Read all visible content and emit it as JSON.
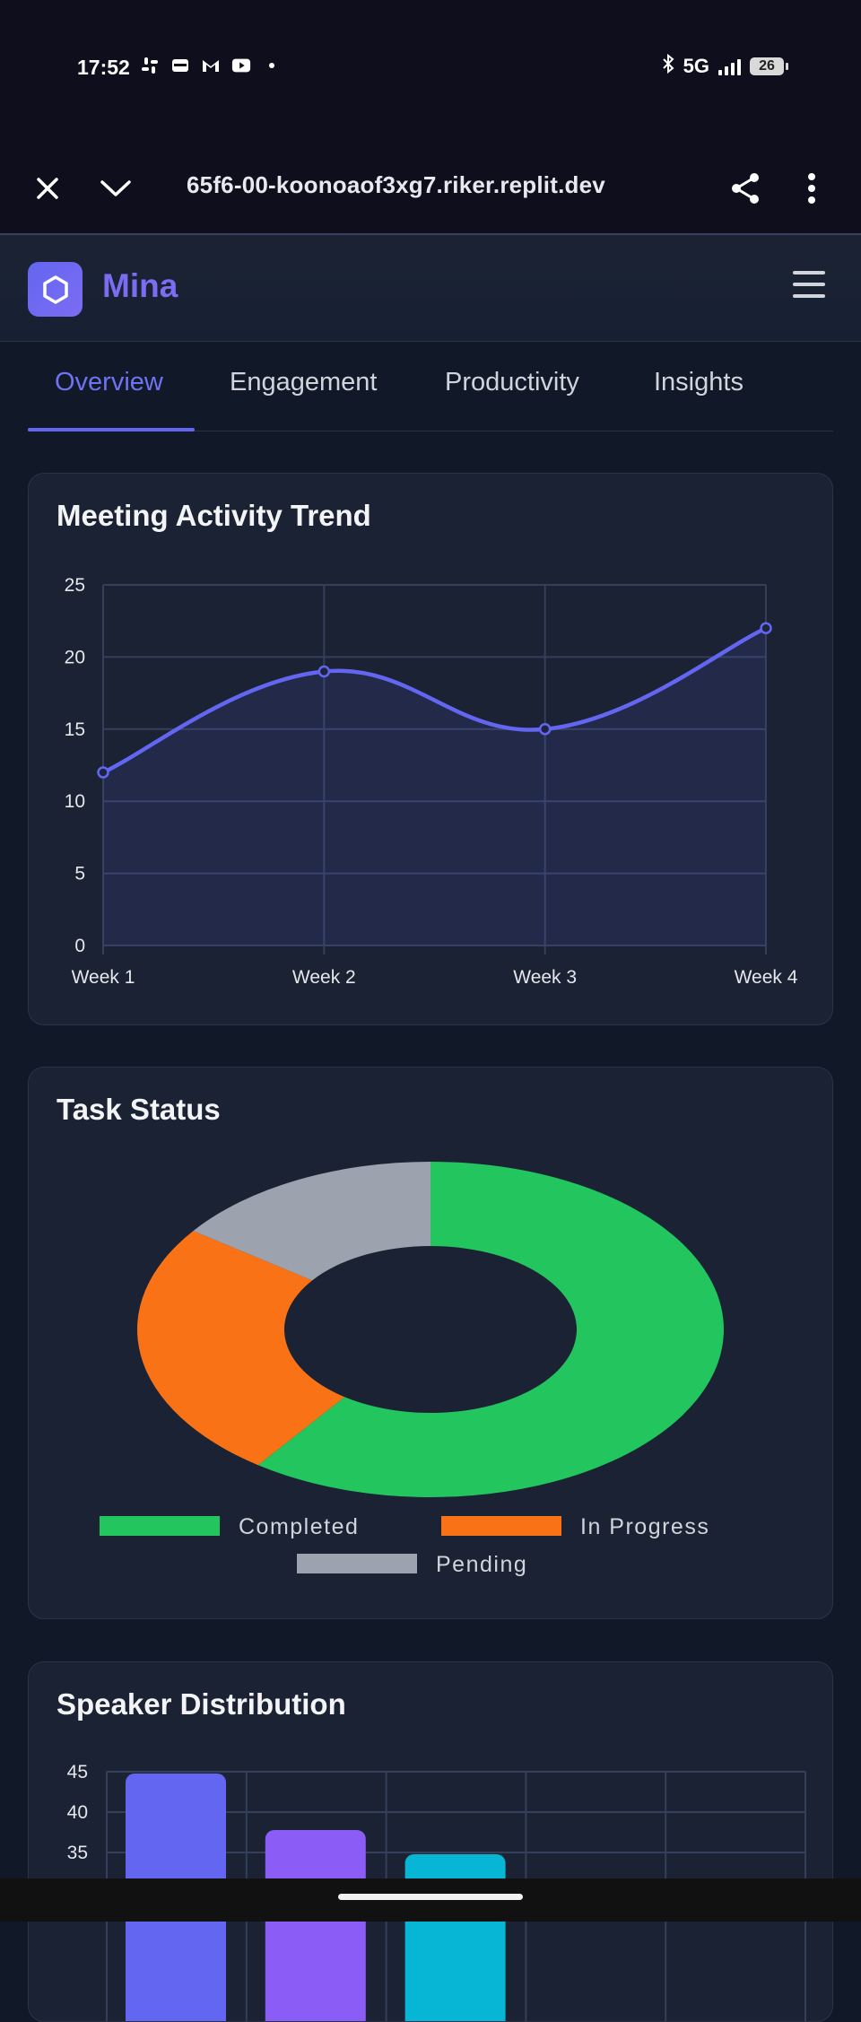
{
  "status_bar": {
    "time": "17:52",
    "network": "5G",
    "battery": "26",
    "left_icons": [
      "slack-icon",
      "wallet-icon",
      "gmail-icon",
      "youtube-icon",
      "dot-icon"
    ]
  },
  "browser": {
    "url": "65f6-00-koonoaof3xg7.riker.replit.dev"
  },
  "app": {
    "name": "Mina"
  },
  "tabs": [
    {
      "label": "Overview",
      "active": true
    },
    {
      "label": "Engagement",
      "active": false
    },
    {
      "label": "Productivity",
      "active": false
    },
    {
      "label": "Insights",
      "active": false
    }
  ],
  "cards": {
    "meeting": {
      "title": "Meeting Activity Trend"
    },
    "tasks": {
      "title": "Task Status"
    },
    "speakers": {
      "title": "Speaker Distribution"
    }
  },
  "chart_data": [
    {
      "type": "line",
      "title": "Meeting Activity Trend",
      "x": [
        "Week 1",
        "Week 2",
        "Week 3",
        "Week 4"
      ],
      "series": [
        {
          "values": [
            12,
            19,
            15,
            22
          ],
          "color": "#6366f1"
        }
      ],
      "ylim": [
        0,
        25
      ],
      "yticks": [
        0,
        5,
        10,
        15,
        20,
        25
      ],
      "grid": true,
      "fill": true
    },
    {
      "type": "pie",
      "title": "Task Status",
      "donut": true,
      "categories": [
        "Completed",
        "In Progress",
        "Pending"
      ],
      "values": [
        60,
        25,
        15
      ],
      "colors": [
        "#22c55e",
        "#f97316",
        "#9ca3af"
      ],
      "legend_position": "bottom"
    },
    {
      "type": "bar",
      "title": "Speaker Distribution",
      "values": [
        45,
        38,
        35
      ],
      "colors": [
        "#6366f1",
        "#8b5cf6",
        "#06b6d4"
      ],
      "yticks": [
        35,
        40,
        45
      ],
      "grid": true
    }
  ]
}
